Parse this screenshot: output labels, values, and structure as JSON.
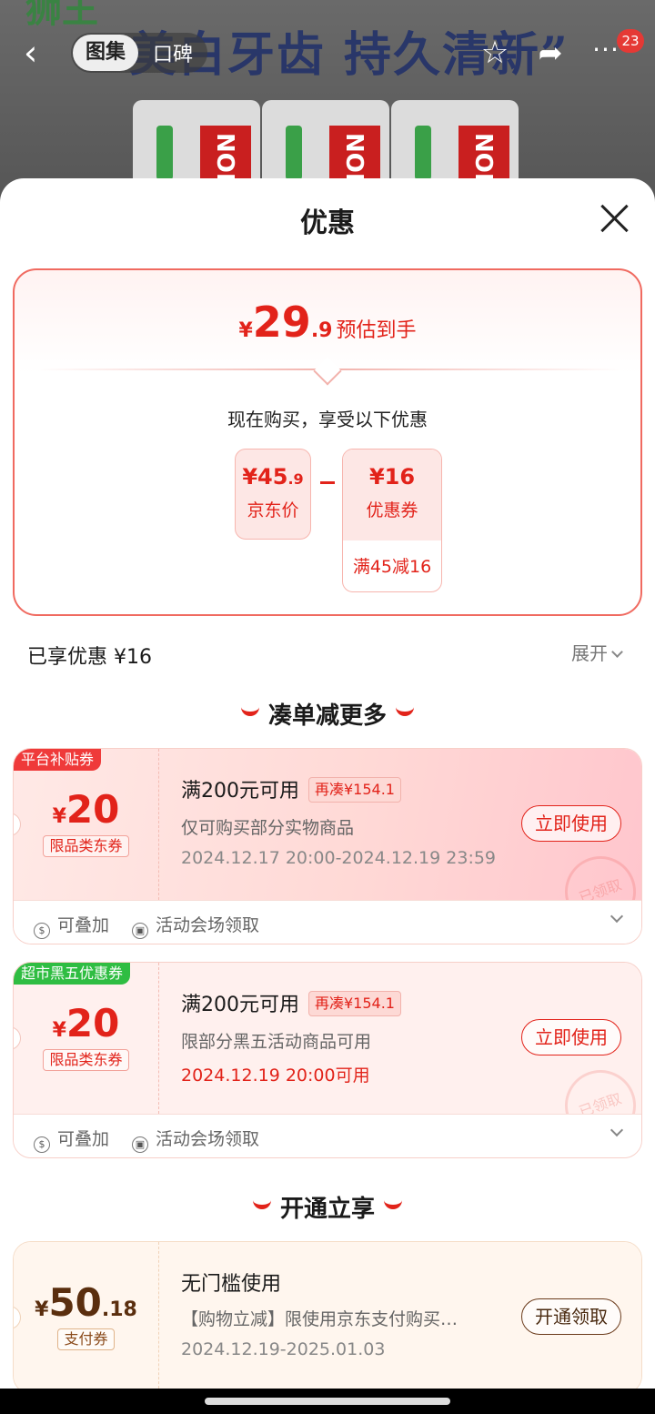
{
  "nav": {
    "tab_active": "图集",
    "tab_inactive": "口碑",
    "badge_count": "23"
  },
  "background": {
    "headline": "“美白牙齿 持久清新”",
    "product_text": "NOIN",
    "brand": "狮王"
  },
  "sheet": {
    "title": "优惠"
  },
  "price_card": {
    "currency": "¥",
    "estimate_int": "29",
    "estimate_dec": ".9",
    "estimate_label": "预估到手",
    "subtitle": "现在购买，享受以下优惠",
    "jd_price_main": "¥45",
    "jd_price_dec": ".9",
    "jd_price_label": "京东价",
    "coupon_value": "¥16",
    "coupon_label": "优惠券",
    "coupon_rule": "满45减16"
  },
  "summary": {
    "enjoyed": "已享优惠 ¥16",
    "expand": "展开"
  },
  "section1": {
    "title": "凑单减更多"
  },
  "section2": {
    "title": "开通立享"
  },
  "coupons": [
    {
      "tag": "平台补贴券",
      "currency": "¥",
      "amount": "20",
      "decimal": "",
      "type": "限品类东券",
      "condition": "满200元可用",
      "need": "再凑¥154.1",
      "desc": "仅可购买部分实物商品",
      "date": "2024.12.17 20:00-2024.12.19 23:59",
      "button": "立即使用",
      "stamp": "已领取",
      "feature1": "可叠加",
      "feature2": "活动会场领取"
    },
    {
      "tag": "超市黑五优惠券",
      "currency": "¥",
      "amount": "20",
      "decimal": "",
      "type": "限品类东券",
      "condition": "满200元可用",
      "need": "再凑¥154.1",
      "desc": "限部分黑五活动商品可用",
      "date": "2024.12.19 20:00可用",
      "button": "立即使用",
      "stamp": "已领取",
      "feature1": "可叠加",
      "feature2": "活动会场领取"
    },
    {
      "tag": "",
      "currency": "¥",
      "amount": "50",
      "decimal": ".18",
      "type": "支付券",
      "condition": "无门槛使用",
      "desc": "【购物立减】限使用京东支付购买…",
      "date": "2024.12.19-2025.01.03",
      "button": "开通领取"
    }
  ],
  "colors": {
    "accent_red": "#e2231a",
    "tag_green": "#2fbd42"
  }
}
